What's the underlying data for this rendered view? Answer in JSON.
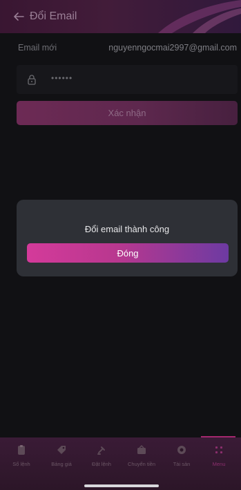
{
  "header": {
    "title": "Đổi Email"
  },
  "email_row": {
    "label": "Email mới",
    "value": "nguyenngocmai2997@gmail.com"
  },
  "password_field": {
    "value": "••••••"
  },
  "confirm_button": {
    "label": "Xác nhận"
  },
  "modal": {
    "message": "Đổi email thành công",
    "button_label": "Đóng"
  },
  "bottom_nav": {
    "items": [
      {
        "label": "Sổ lệnh",
        "icon": "orderbook-icon"
      },
      {
        "label": "Bảng giá",
        "icon": "price-tag-icon"
      },
      {
        "label": "Đặt lệnh",
        "icon": "place-order-icon"
      },
      {
        "label": "Chuyển tiền",
        "icon": "transfer-icon"
      },
      {
        "label": "Tài sản",
        "icon": "assets-icon"
      },
      {
        "label": "Menu",
        "icon": "menu-grid-icon"
      }
    ],
    "active_index": 5
  },
  "colors": {
    "accent_pink": "#d43a9a",
    "accent_purple": "#6d3aa2",
    "background": "#111114",
    "modal_bg": "#2e3036"
  }
}
